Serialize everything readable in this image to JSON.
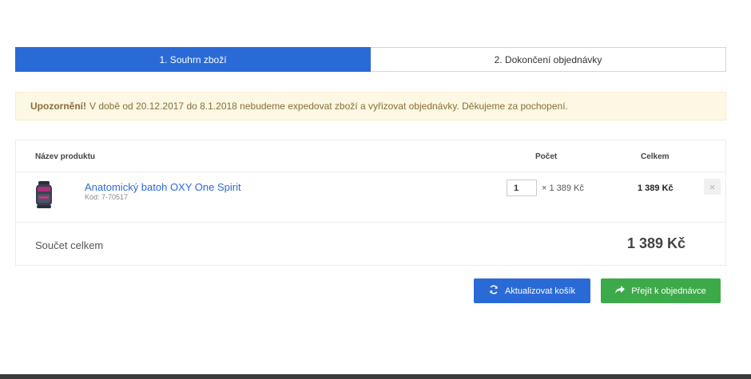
{
  "steps": [
    {
      "label": "1. Souhrn zboží",
      "active": true
    },
    {
      "label": "2. Dokončení objednávky",
      "active": false
    }
  ],
  "alert": {
    "title": "Upozornění!",
    "text": "V době od 20.12.2017 do 8.1.2018 nebudeme expedovat zboží a vyřizovat objednávky. Děkujeme za pochopení."
  },
  "cart": {
    "headers": {
      "name": "Název produktu",
      "qty": "Počet",
      "total": "Celkem"
    },
    "items": [
      {
        "name": "Anatomický batoh OXY One Spirit",
        "code": "Kód: 7-70517",
        "quantity": "1",
        "unit_price": "× 1 389 Kč",
        "total": "1 389 Kč",
        "remove_icon": "×"
      }
    ],
    "summary": {
      "label": "Součet celkem",
      "value": "1 389 Kč"
    }
  },
  "buttons": {
    "update": {
      "label": "Aktualizovat košík",
      "icon": "refresh-icon"
    },
    "next": {
      "label": "Přejít k objednávce",
      "icon": "share-arrow-icon"
    }
  },
  "colors": {
    "primary": "#2a6ad7",
    "success": "#3daa4a",
    "alert_bg": "#fcf8e3",
    "alert_text": "#8a6d3b"
  }
}
